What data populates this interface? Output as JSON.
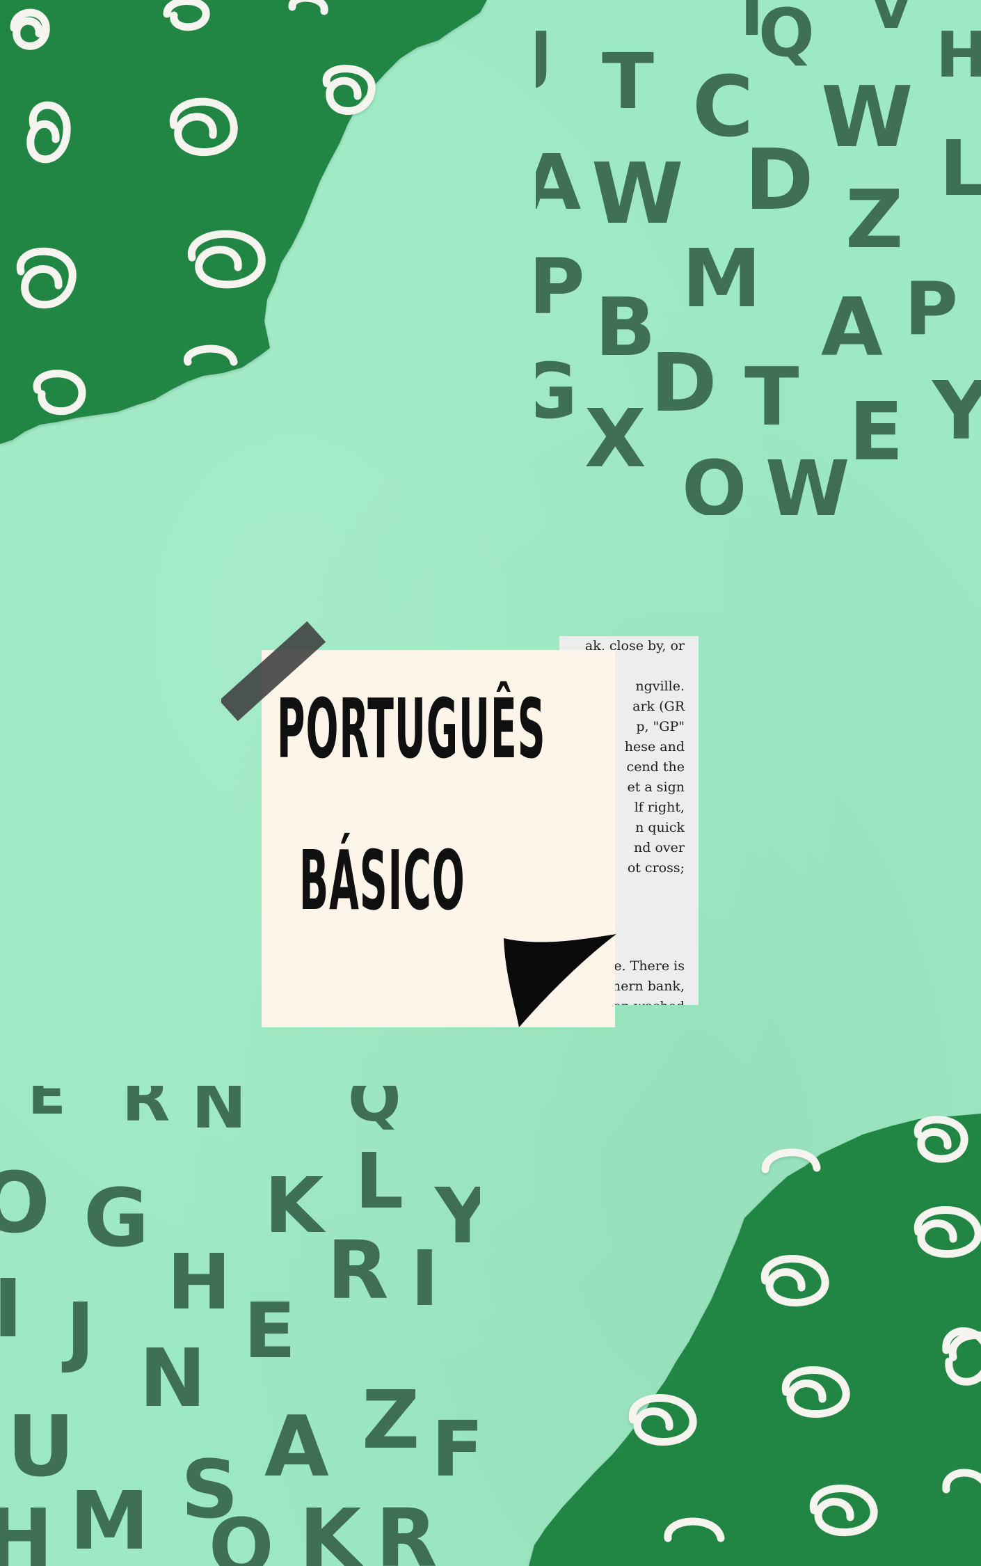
{
  "cover": {
    "title_line1": "PORTUGUÊS",
    "title_line2": "BÁSICO"
  },
  "clipping": {
    "lines_top": [
      "ak, close by, or",
      "",
      "ngville.",
      "ark (GR",
      "p,  \"GP\"",
      "hese and",
      "cend the",
      "et a sign",
      "lf right,",
      "n  quick",
      "nd  over",
      "ot cross;"
    ],
    "lines_bottom": [
      "idge.  There is",
      "ns southern bank,",
      "have been washed"
    ]
  },
  "letters_top_right": [
    "T",
    "Q",
    "V",
    "H",
    "J",
    "T",
    "C",
    "W",
    "L",
    "A",
    "W",
    "D",
    "Z",
    "P",
    "M",
    "P",
    "B",
    "A",
    "P",
    "G",
    "D",
    "T",
    "E",
    "Y",
    "X",
    "O",
    "W"
  ],
  "letters_bottom_left": [
    "E",
    "R",
    "N",
    "Q",
    "O",
    "G",
    "K",
    "L",
    "Y",
    "H",
    "R",
    "I",
    "J",
    "E",
    "N",
    "U",
    "A",
    "Z",
    "S",
    "M",
    "H",
    "K",
    "R",
    "O"
  ],
  "colors": {
    "background": "#9ce9c3",
    "dark_green": "#218544",
    "note_paper": "#fdf5ea",
    "tape": "#4a4a4a",
    "letters": "#2f5a43"
  }
}
